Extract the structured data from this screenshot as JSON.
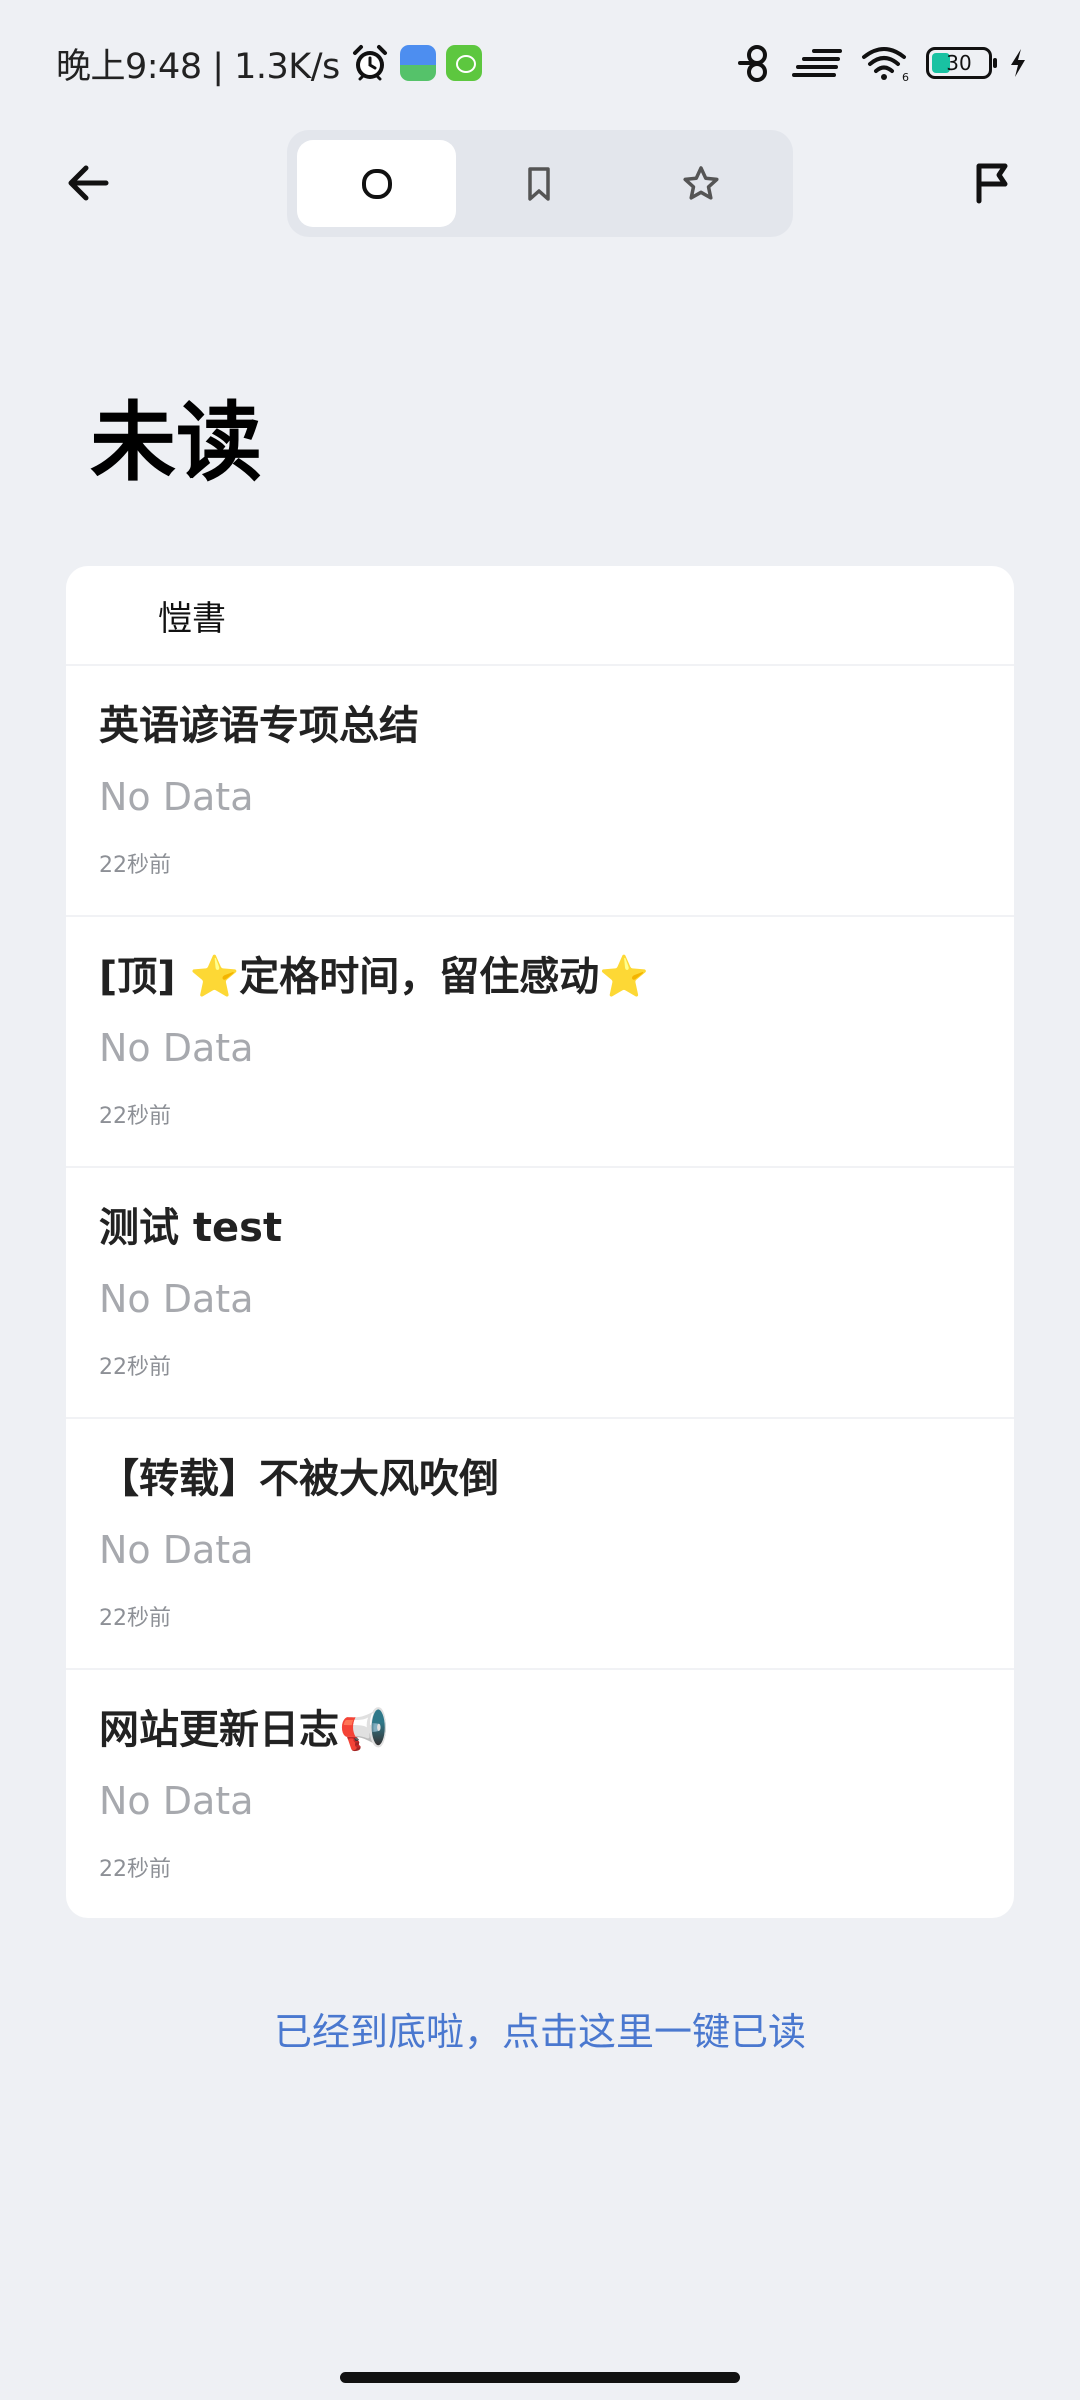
{
  "status_bar": {
    "time_speed": "晚上9:48 | 1.3K/s",
    "battery": "30",
    "icons": [
      "alarm-icon",
      "gallery-app-icon",
      "cat-app-icon",
      "hd-icon",
      "signal-icon",
      "wifi-icon",
      "battery-icon",
      "charging-icon"
    ]
  },
  "header": {
    "tabs": [
      {
        "name": "unread",
        "icon": "circle-icon",
        "active": true
      },
      {
        "name": "bookmarks",
        "icon": "bookmark-icon",
        "active": false
      },
      {
        "name": "starred",
        "icon": "star-icon",
        "active": false
      }
    ],
    "icons": [
      "back-arrow-icon",
      "flag-icon"
    ]
  },
  "page": {
    "title": "未读"
  },
  "feed": {
    "source_name": "愷書",
    "items": [
      {
        "title": "英语谚语专项总结",
        "summary": "No Data",
        "time": "22秒前"
      },
      {
        "title": "[顶] ⭐定格时间，留住感动⭐",
        "summary": "No Data",
        "time": "22秒前"
      },
      {
        "title": "测试 test",
        "summary": "No Data",
        "time": "22秒前"
      },
      {
        "title": "【转载】不被大风吹倒",
        "summary": "No Data",
        "time": "22秒前"
      },
      {
        "title": "网站更新日志📢",
        "summary": "No Data",
        "time": "22秒前"
      }
    ]
  },
  "footer": {
    "mark_all_read": "已经到底啦，点击这里一键已读"
  },
  "colors": {
    "background": "#eef0f4",
    "card": "#ffffff",
    "link": "#4a78cf",
    "muted": "#a7a9ae",
    "battery": "#19c2a2"
  }
}
